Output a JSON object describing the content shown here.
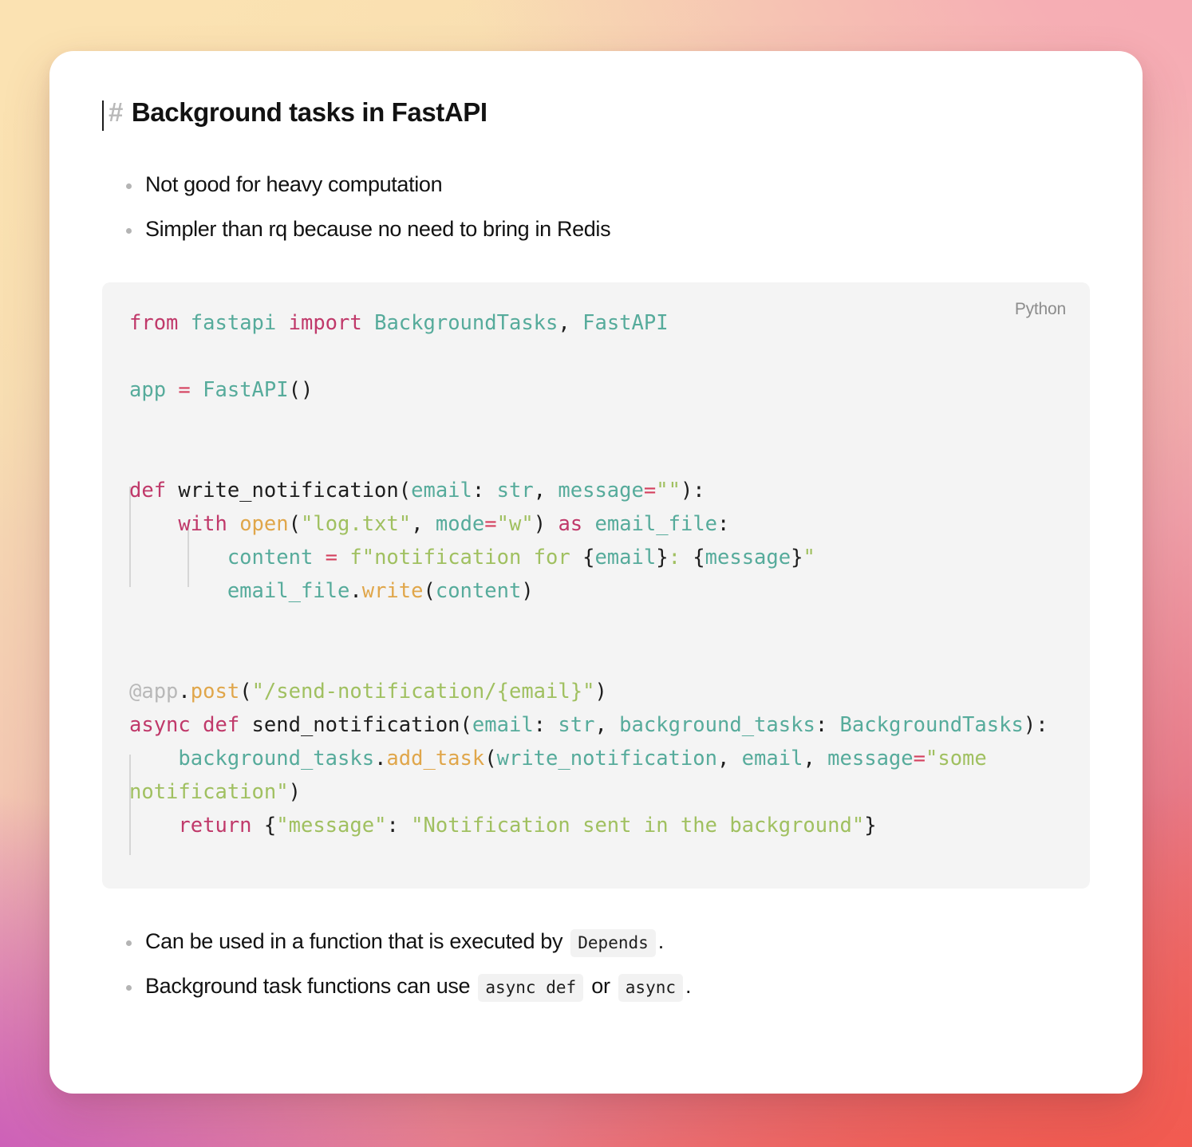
{
  "background": {
    "gradient_colors": [
      "#fae0ad",
      "#f6dcb2",
      "#f3c8b2",
      "#ef9fa8",
      "#e87a88",
      "#ef6357",
      "#c452b8"
    ]
  },
  "card": {
    "background_color": "#ffffff"
  },
  "heading": {
    "markdown_marker": "#",
    "text": "Background tasks in FastAPI",
    "has_caret": true
  },
  "bullets_top": [
    {
      "text": "Not good for heavy computation"
    },
    {
      "text": "Simpler than rq because no need to bring in Redis"
    }
  ],
  "code_block": {
    "language_label": "Python",
    "background_color": "#f4f4f4",
    "syntax_colors": {
      "keyword": "#c0396a",
      "identifier": "#56ab9b",
      "function": "#e0a64a",
      "string": "#a0c060",
      "punctuation": "#1d1d1d",
      "decorator": "#b8b8b8",
      "operator": "#d4405e"
    },
    "source": "from fastapi import BackgroundTasks, FastAPI\n\napp = FastAPI()\n\n\ndef write_notification(email: str, message=\"\"):\n    with open(\"log.txt\", mode=\"w\") as email_file:\n        content = f\"notification for {email}: {message}\"\n        email_file.write(content)\n\n\n@app.post(\"/send-notification/{email}\")\nasync def send_notification(email: str, background_tasks: BackgroundTasks):\n    background_tasks.add_task(write_notification, email, message=\"some notification\")\n    return {\"message\": \"Notification sent in the background\"}"
  },
  "bullets_bottom": [
    {
      "parts": [
        {
          "type": "text",
          "value": "Can be used in a function that is executed by"
        },
        {
          "type": "code",
          "value": "Depends"
        },
        {
          "type": "text",
          "value": "."
        }
      ]
    },
    {
      "parts": [
        {
          "type": "text",
          "value": "Background task functions can use"
        },
        {
          "type": "code",
          "value": "async def"
        },
        {
          "type": "text",
          "value": "or"
        },
        {
          "type": "code",
          "value": "async"
        },
        {
          "type": "text",
          "value": "."
        }
      ]
    }
  ]
}
